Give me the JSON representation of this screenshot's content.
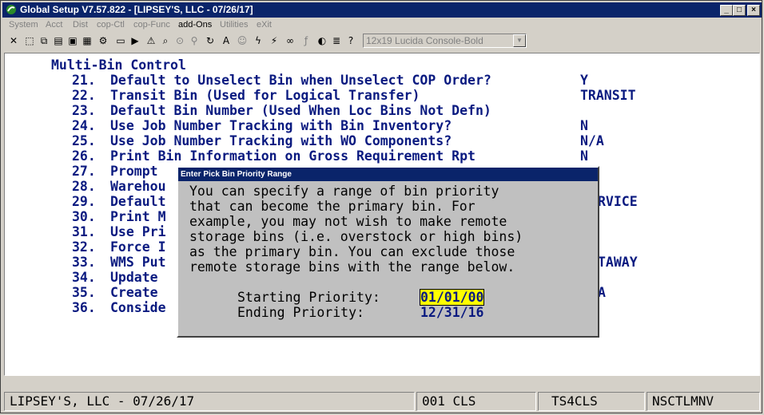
{
  "window": {
    "title": "Global Setup V7.57.822 - [LIPSEY'S, LLC - 07/26/17]"
  },
  "menu": [
    {
      "label": "System",
      "enabled": false
    },
    {
      "label": "Acct",
      "enabled": false
    },
    {
      "label": "Dist",
      "enabled": false
    },
    {
      "label": "cop-Ctl",
      "enabled": false
    },
    {
      "label": "cop-Func",
      "enabled": false
    },
    {
      "label": "add-Ons",
      "enabled": true
    },
    {
      "label": "Utilities",
      "enabled": false
    },
    {
      "label": "eXit",
      "enabled": false
    }
  ],
  "toolbar": {
    "font_select": "12x19 Lucida Console-Bold"
  },
  "screen": {
    "section_title": "Multi-Bin Control",
    "lines": [
      {
        "num": "21.",
        "text": "Default to Unselect Bin when Unselect COP Order?",
        "value": "Y"
      },
      {
        "num": "22.",
        "text": "Transit Bin (Used for Logical Transfer)",
        "value": "TRANSIT"
      },
      {
        "num": "23.",
        "text": "Default Bin Number (Used When Loc Bins Not Defn)",
        "value": ""
      },
      {
        "num": "24.",
        "text": "Use Job Number Tracking with Bin Inventory?",
        "value": "N"
      },
      {
        "num": "25.",
        "text": "Use Job Number Tracking with WO Components?",
        "value": "N/A"
      },
      {
        "num": "26.",
        "text": "Print Bin Information on Gross Requirement Rpt",
        "value": "N"
      },
      {
        "num": "27.",
        "text": "Prompt",
        "value": ""
      },
      {
        "num": "28.",
        "text": "Warehou",
        "value": ""
      },
      {
        "num": "29.",
        "text": "Default",
        "value": "RVICE"
      },
      {
        "num": "30.",
        "text": "Print M",
        "value": ""
      },
      {
        "num": "31.",
        "text": "Use Pri",
        "value": ""
      },
      {
        "num": "32.",
        "text": "Force I",
        "value": ""
      },
      {
        "num": "33.",
        "text": "WMS Put",
        "value": "TAWAY"
      },
      {
        "num": "34.",
        "text": "Update",
        "value": ""
      },
      {
        "num": "35.",
        "text": "Create",
        "value": "A"
      },
      {
        "num": "36.",
        "text": "Conside",
        "value": ""
      }
    ]
  },
  "dialog": {
    "title": "Enter Pick Bin Priority Range",
    "message": [
      "You can specify a range of bin priority",
      "that can become the primary bin. For",
      "example, you may not wish to make remote",
      "storage bins (i.e. overstock or high bins)",
      "as the primary bin. You can exclude those",
      "remote storage bins with the range below."
    ],
    "starting_label": "Starting Priority:",
    "starting_value": "01/01/00",
    "ending_label": "Ending Priority:",
    "ending_value": "12/31/16"
  },
  "status": {
    "company": "LIPSEY'S, LLC - 07/26/17",
    "code": "001 CLS",
    "terminal": "TS4CLS",
    "program": "NSCTLMNV"
  }
}
